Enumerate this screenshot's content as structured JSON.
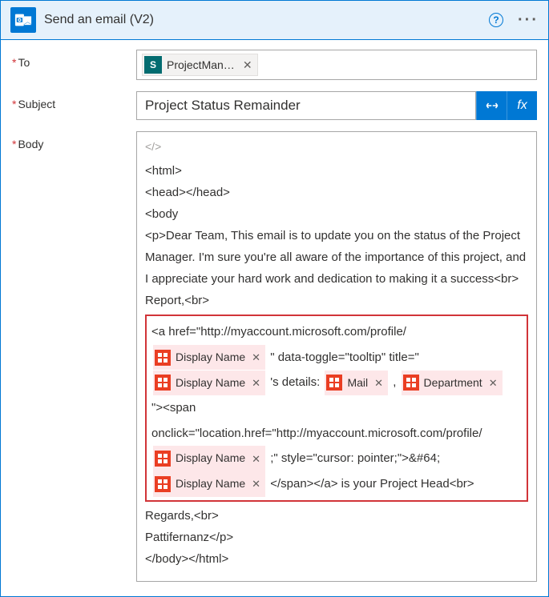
{
  "header": {
    "title": "Send an email (V2)"
  },
  "fields": {
    "to_label": "To",
    "subject_label": "Subject",
    "body_label": "Body"
  },
  "to": {
    "chip_label": "ProjectMan…"
  },
  "subject": {
    "value": "Project Status Remainder"
  },
  "body": {
    "code_toggle": "</>",
    "l1": "<html>",
    "l2": "<head></head>",
    "l3": "<body",
    "l4": "<p>Dear Team, This email is to update you on the status of the Project Manager. I'm sure you're all aware of the importance of this project, and I appreciate your hard work and dedication to making it a success<br>",
    "l5": "Report,<br>",
    "r1a": "<a href=\"http://myaccount.microsoft.com/profile/",
    "dn": "Display Name",
    "r1b": "\" data-toggle=\"tooltip\" title=\"",
    "r2a": "'s details:",
    "mail": "Mail",
    "comma": ",",
    "dept": "Department",
    "r3": "\"><span onclick=\"location.href=\"http://myaccount.microsoft.com/profile/",
    "r4a": ";\" style=\"cursor: pointer;\">&#64;",
    "r5a": "</span></a> is your Project Head<br>",
    "l6": "Regards,<br>",
    "l7": "Pattifernanz</p>",
    "l8": "</body></html>"
  },
  "fx_label": "fx"
}
